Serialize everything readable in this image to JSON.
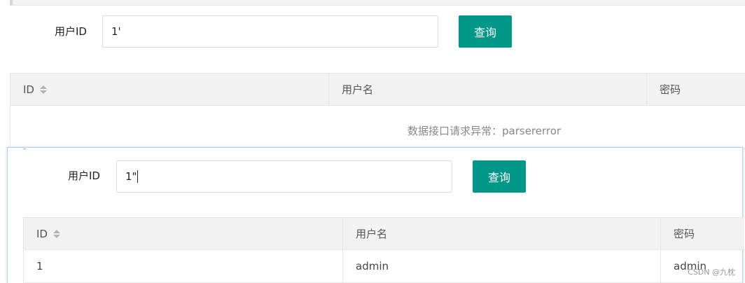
{
  "form1": {
    "label": "用户ID",
    "input_value": "1'",
    "button_label": "查询"
  },
  "table1": {
    "columns": [
      "ID",
      "用户名",
      "密码"
    ],
    "empty_message": "数据接口请求异常：parsererror"
  },
  "form2": {
    "label": "用户ID",
    "input_value": "1\"",
    "button_label": "查询"
  },
  "table2": {
    "columns": [
      "ID",
      "用户名",
      "密码"
    ],
    "rows": [
      [
        "1",
        "admin",
        "admin"
      ]
    ]
  },
  "watermark": "CSDN @九枕",
  "colors": {
    "accent": "#009688",
    "header_bg": "#f2f2f2",
    "border": "#e6e6e6"
  }
}
